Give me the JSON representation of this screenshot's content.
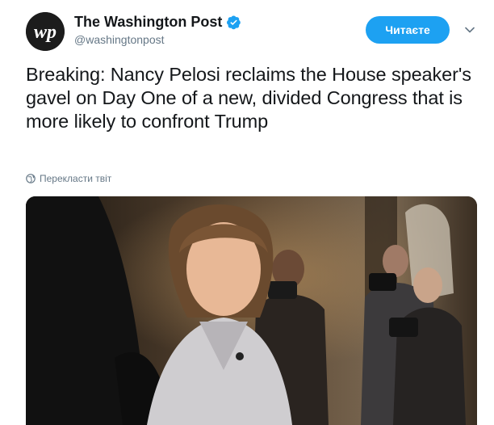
{
  "account": {
    "name": "The Washington Post",
    "handle": "@washingtonpost",
    "verified": true,
    "avatar_monogram": "wp"
  },
  "follow_button": {
    "label": "Читаєте"
  },
  "tweet": {
    "text": "Breaking: Nancy Pelosi reclaims the House speaker's gavel on Day One of a new, divided Congress that is more likely to confront Trump"
  },
  "translate": {
    "label": "Перекласти твіт",
    "icon": "globe-icon"
  },
  "media": {
    "kind": "photo"
  },
  "colors": {
    "accent": "#1da1f2",
    "text": "#14171a",
    "secondary": "#657786"
  }
}
